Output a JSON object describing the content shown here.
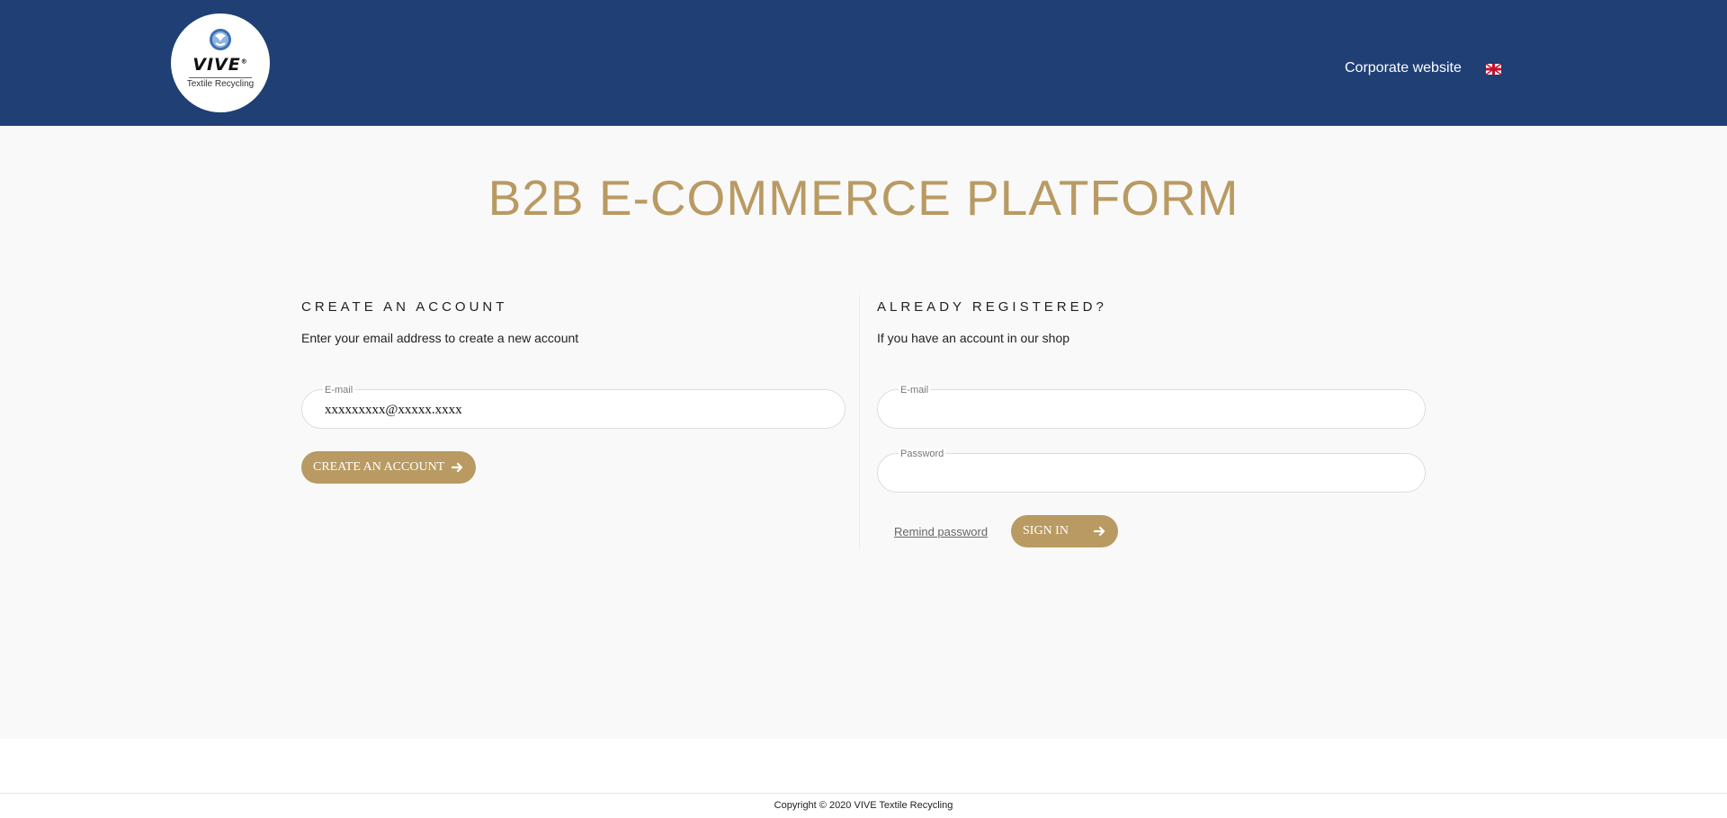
{
  "header": {
    "logo": {
      "wordmark": "VIVE",
      "registered": "®",
      "tagline": "Textile Recycling"
    },
    "corporate_link": "Corporate website",
    "language_flag_icon": "uk-flag-icon",
    "background_color": "#1f3f75"
  },
  "main": {
    "title": "B2B E-COMMERCE PLATFORM",
    "accent_color": "#b99a62",
    "create_account": {
      "heading": "CREATE AN ACCOUNT",
      "description": "Enter your email address to create a new account",
      "email_label": "E-mail",
      "email_value": "xxxxxxxxx@xxxxx.xxxx",
      "button_label": "CREATE AN ACCOUNT",
      "button_icon": "arrow-right-icon"
    },
    "sign_in": {
      "heading": "ALREADY REGISTERED?",
      "description": "If you have an account in our shop",
      "email_label": "E-mail",
      "email_value": "",
      "password_label": "Password",
      "password_value": "",
      "remind_link": "Remind password",
      "button_label": "SIGN IN",
      "button_icon": "arrow-right-icon"
    }
  },
  "footer": {
    "copyright": "Copyright © 2020 VIVE Textile Recycling"
  }
}
